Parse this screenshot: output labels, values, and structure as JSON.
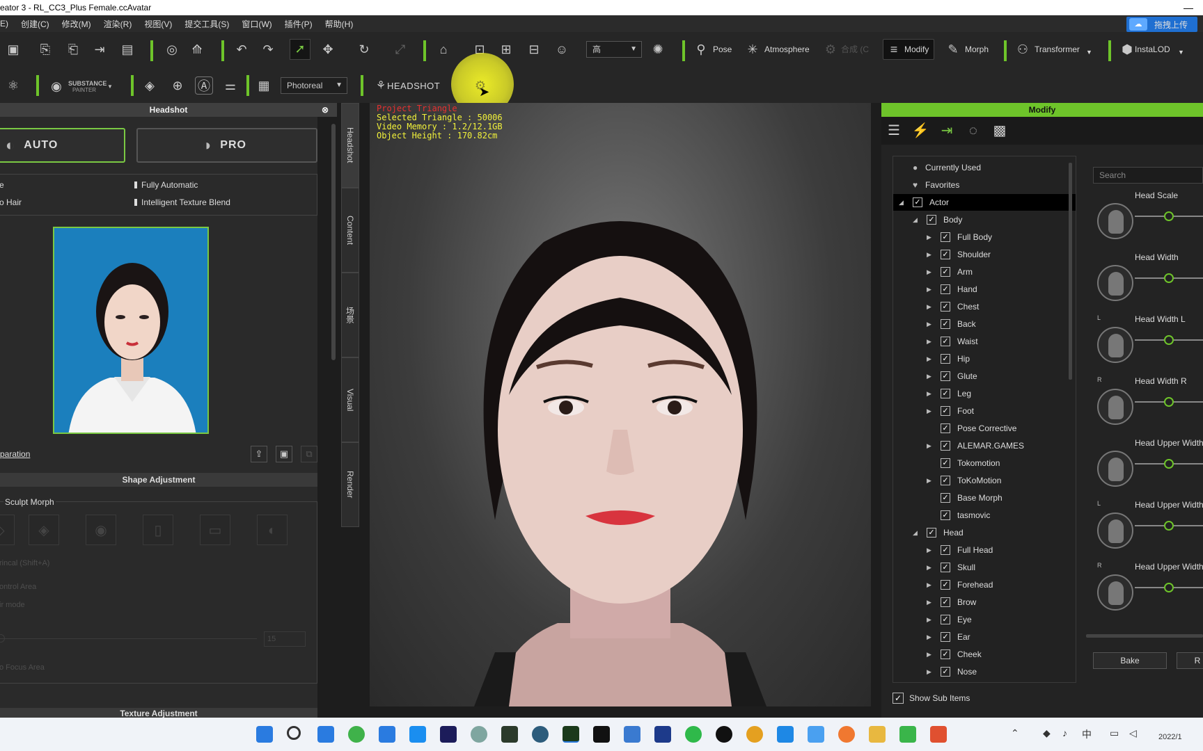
{
  "window": {
    "title": "eator 3 - RL_CC3_Plus Female.ccAvatar",
    "minimize": "—"
  },
  "menu": [
    "E)",
    "创建(C)",
    "修改(M)",
    "渲染(R)",
    "视图(V)",
    "提交工具(S)",
    "窗口(W)",
    "插件(P)",
    "帮助(H)"
  ],
  "upload_button": "拖拽上传",
  "toolbar": {
    "quality_select": "高",
    "pose": "Pose",
    "atmosphere": "Atmosphere",
    "disabled_item": "合成 (C",
    "modify": "Modify",
    "morph": "Morph",
    "transformer": "Transformer",
    "instalod": "InstaLOD",
    "substance_line1": "SUBSTANCE",
    "substance_line2": "PAINTER",
    "render_select": "Photoreal",
    "headshot": "HEADSHOT"
  },
  "headshot_panel": {
    "title": "Headshot",
    "auto_label": "AUTO",
    "pro_label": "PRO",
    "options": [
      "e",
      "Fully Automatic",
      "o Hair",
      "Intelligent Texture Blend"
    ],
    "link": "paration",
    "shape_adjustment": "Shape Adjustment",
    "sculpt_morph": "Sculpt Morph",
    "dim_lines": [
      "rincal (Shift+A)",
      "ontrol Area",
      "ir mode",
      "o Focus Area"
    ],
    "spin_value": "15",
    "texture_adjustment": "Texture Adjustment"
  },
  "side_tabs": [
    "Headshot",
    "Content",
    "场景",
    "Visual",
    "Render"
  ],
  "viewport": {
    "stats": [
      "Project Triangle",
      "Selected Triangle : 50006",
      "Video Memory : 1.2/12.1GB",
      "Object Height : 170.82cm"
    ]
  },
  "modify_panel": {
    "title": "Modify",
    "tree": [
      {
        "label": "Currently Used",
        "level": 0,
        "kind": "dot"
      },
      {
        "label": "Favorites",
        "level": 0,
        "kind": "heart"
      },
      {
        "label": "Actor",
        "level": 0,
        "kind": "expanded",
        "selected": true
      },
      {
        "label": "Body",
        "level": 1,
        "kind": "expanded"
      },
      {
        "label": "Full Body",
        "level": 2,
        "kind": "collapsed"
      },
      {
        "label": "Shoulder",
        "level": 2,
        "kind": "collapsed"
      },
      {
        "label": "Arm",
        "level": 2,
        "kind": "collapsed"
      },
      {
        "label": "Hand",
        "level": 2,
        "kind": "collapsed"
      },
      {
        "label": "Chest",
        "level": 2,
        "kind": "collapsed"
      },
      {
        "label": "Back",
        "level": 2,
        "kind": "collapsed"
      },
      {
        "label": "Waist",
        "level": 2,
        "kind": "collapsed"
      },
      {
        "label": "Hip",
        "level": 2,
        "kind": "collapsed"
      },
      {
        "label": "Glute",
        "level": 2,
        "kind": "collapsed"
      },
      {
        "label": "Leg",
        "level": 2,
        "kind": "collapsed"
      },
      {
        "label": "Foot",
        "level": 2,
        "kind": "collapsed"
      },
      {
        "label": "Pose Corrective",
        "level": 2,
        "kind": "leaf"
      },
      {
        "label": "ALEMAR.GAMES",
        "level": 2,
        "kind": "collapsed"
      },
      {
        "label": "Tokomotion",
        "level": 2,
        "kind": "leaf"
      },
      {
        "label": "ToKoMotion",
        "level": 2,
        "kind": "collapsed"
      },
      {
        "label": "Base Morph",
        "level": 2,
        "kind": "leaf"
      },
      {
        "label": "tasmovic",
        "level": 2,
        "kind": "leaf"
      },
      {
        "label": "Head",
        "level": 1,
        "kind": "expanded"
      },
      {
        "label": "Full Head",
        "level": 2,
        "kind": "collapsed"
      },
      {
        "label": "Skull",
        "level": 2,
        "kind": "collapsed"
      },
      {
        "label": "Forehead",
        "level": 2,
        "kind": "collapsed"
      },
      {
        "label": "Brow",
        "level": 2,
        "kind": "collapsed"
      },
      {
        "label": "Eye",
        "level": 2,
        "kind": "collapsed"
      },
      {
        "label": "Ear",
        "level": 2,
        "kind": "collapsed"
      },
      {
        "label": "Cheek",
        "level": 2,
        "kind": "collapsed"
      },
      {
        "label": "Nose",
        "level": 2,
        "kind": "collapsed"
      }
    ],
    "search_placeholder": "Search",
    "sliders": [
      {
        "label": "Head Scale",
        "side": "",
        "value": 0.5
      },
      {
        "label": "Head Width",
        "side": "",
        "value": 0.5
      },
      {
        "label": "Head Width L",
        "side": "L",
        "value": 0.5
      },
      {
        "label": "Head Width R",
        "side": "R",
        "value": 0.5
      },
      {
        "label": "Head Upper Width",
        "side": "",
        "value": 0.5
      },
      {
        "label": "Head Upper Width",
        "side": "L",
        "value": 0.5
      },
      {
        "label": "Head Upper Width",
        "side": "R",
        "value": 0.5
      }
    ],
    "bake": "Bake",
    "reset_partial": "R",
    "show_sub_items": "Show Sub Items"
  },
  "taskbar": {
    "clock": "2022/1"
  },
  "colors": {
    "accent_green": "#6ec42a",
    "stats_yellow": "#f2f23a",
    "selected_border": "#7ac943"
  }
}
